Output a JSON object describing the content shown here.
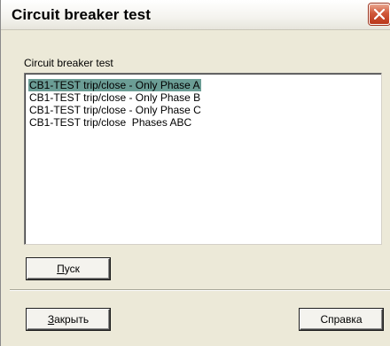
{
  "window": {
    "title": "Circuit breaker test"
  },
  "dialog": {
    "group_label": "Circuit breaker test",
    "list_items": [
      {
        "label": "CB1-TEST trip/close - Only Phase A",
        "selected": true
      },
      {
        "label": "CB1-TEST trip/close - Only Phase B",
        "selected": false
      },
      {
        "label": "CB1-TEST trip/close - Only Phase C",
        "selected": false
      },
      {
        "label": "CB1-TEST trip/close  Phases ABC",
        "selected": false
      }
    ],
    "start_button": {
      "accel": "П",
      "rest": "уск"
    },
    "close_button": {
      "accel": "З",
      "rest": "акрыть"
    },
    "help_button": "Справка"
  },
  "icons": {
    "close": "close-icon"
  },
  "colors": {
    "selection": "#6b9d95",
    "close_button": "#d0583a",
    "face": "#ece9d8"
  }
}
